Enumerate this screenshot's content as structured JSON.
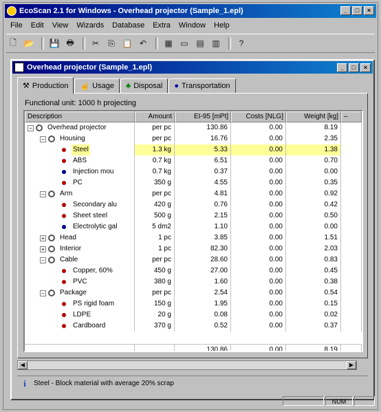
{
  "app": {
    "title": "EcoScan 2.1 for Windows - Overhead projector (Sample_1.epl)",
    "menu": [
      "File",
      "Edit",
      "View",
      "Wizards",
      "Database",
      "Extra",
      "Window",
      "Help"
    ],
    "toolbar_icons": [
      "new-file-icon",
      "open-folder-icon",
      "save-icon",
      "print-icon",
      "cut-icon",
      "copy-icon",
      "paste-icon",
      "undo-icon",
      "product-icon",
      "help-icon"
    ]
  },
  "doc": {
    "title": "Overhead projector (Sample_1.epl)",
    "tabs": [
      {
        "label": "Production",
        "icon": "wrench-icon",
        "color": "#000000"
      },
      {
        "label": "Usage",
        "icon": "hand-icon",
        "color": "#000000"
      },
      {
        "label": "Disposal",
        "icon": "tree-icon",
        "color": "#008000"
      },
      {
        "label": "Transportation",
        "icon": "globe-icon",
        "color": "#0000aa"
      }
    ],
    "functional_unit": "Functional unit: 1000 h projecting",
    "columns": [
      "Description",
      "Amount",
      "EI-95 [mPt]",
      "Costs [NLG]",
      "Weight [kg]"
    ],
    "rows": [
      {
        "desc": "Overhead projector",
        "amount": "per pc",
        "ei": "130.86",
        "cost": "0.00",
        "weight": "8.19"
      },
      {
        "desc": "Housing",
        "amount": "per pc",
        "ei": "16.76",
        "cost": "0.00",
        "weight": "2.35"
      },
      {
        "desc": "Steel",
        "amount": "1.3 kg",
        "ei": "5.33",
        "cost": "0.00",
        "weight": "1.38"
      },
      {
        "desc": "ABS",
        "amount": "0.7 kg",
        "ei": "6.51",
        "cost": "0.00",
        "weight": "0.70"
      },
      {
        "desc": "Injection mou",
        "amount": "0.7 kg",
        "ei": "0.37",
        "cost": "0.00",
        "weight": "0.00"
      },
      {
        "desc": "PC",
        "amount": "350 g",
        "ei": "4.55",
        "cost": "0.00",
        "weight": "0.35"
      },
      {
        "desc": "Arm",
        "amount": "per pc",
        "ei": "4.81",
        "cost": "0.00",
        "weight": "0.92"
      },
      {
        "desc": "Secondary alu",
        "amount": "420 g",
        "ei": "0.76",
        "cost": "0.00",
        "weight": "0.42"
      },
      {
        "desc": "Sheet steel",
        "amount": "500 g",
        "ei": "2.15",
        "cost": "0.00",
        "weight": "0.50"
      },
      {
        "desc": "Electrolytic gal",
        "amount": "5 dm2",
        "ei": "1.10",
        "cost": "0.00",
        "weight": "0.00"
      },
      {
        "desc": "Head",
        "amount": "1 pc",
        "ei": "3.85",
        "cost": "0.00",
        "weight": "1.51"
      },
      {
        "desc": "Interior",
        "amount": "1 pc",
        "ei": "82.30",
        "cost": "0.00",
        "weight": "2.03"
      },
      {
        "desc": "Cable",
        "amount": "per pc",
        "ei": "28.60",
        "cost": "0.00",
        "weight": "0.83"
      },
      {
        "desc": "Copper, 60%",
        "amount": "450 g",
        "ei": "27.00",
        "cost": "0.00",
        "weight": "0.45"
      },
      {
        "desc": "PVC",
        "amount": "380 g",
        "ei": "1.60",
        "cost": "0.00",
        "weight": "0.38"
      },
      {
        "desc": "Package",
        "amount": "per pc",
        "ei": "2.54",
        "cost": "0.00",
        "weight": "0.54"
      },
      {
        "desc": "PS rigid foam",
        "amount": "150 g",
        "ei": "1.95",
        "cost": "0.00",
        "weight": "0.15"
      },
      {
        "desc": "LDPE",
        "amount": "20 g",
        "ei": "0.08",
        "cost": "0.00",
        "weight": "0.02"
      },
      {
        "desc": "Cardboard",
        "amount": "370 g",
        "ei": "0.52",
        "cost": "0.00",
        "weight": "0.37"
      }
    ],
    "totals": {
      "ei": "130.86",
      "cost": "0.00",
      "weight": "8.19"
    },
    "status": "Steel - Block material with average 20% scrap"
  },
  "appstatus": [
    "NUM"
  ],
  "colors": {
    "highlight": "#ffff99",
    "material_dot": "#b00000",
    "process_dot": "#00008b"
  }
}
